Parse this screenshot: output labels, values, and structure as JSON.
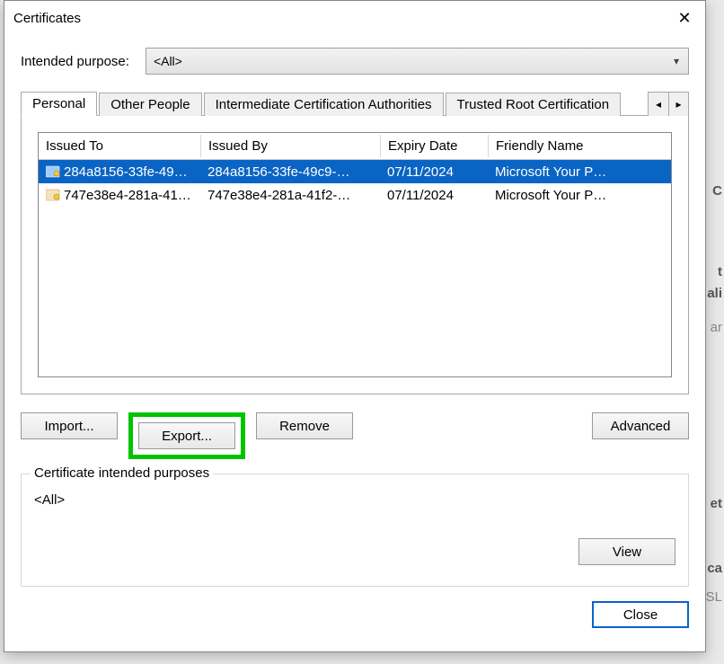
{
  "window": {
    "title": "Certificates"
  },
  "intended_purpose": {
    "label": "Intended purpose:",
    "value": "<All>"
  },
  "tabs": [
    {
      "label": "Personal",
      "active": true
    },
    {
      "label": "Other People",
      "active": false
    },
    {
      "label": "Intermediate Certification Authorities",
      "active": false
    },
    {
      "label": "Trusted Root Certification",
      "active": false,
      "truncated": true
    }
  ],
  "list": {
    "columns": {
      "issued_to": "Issued To",
      "issued_by": "Issued By",
      "expiry_date": "Expiry Date",
      "friendly_name": "Friendly Name"
    },
    "rows": [
      {
        "issued_to": "284a8156-33fe-49…",
        "issued_by": "284a8156-33fe-49c9-…",
        "expiry_date": "07/11/2024",
        "friendly_name": "Microsoft Your P…",
        "selected": true,
        "icon_tint": "blue"
      },
      {
        "issued_to": "747e38e4-281a-41…",
        "issued_by": "747e38e4-281a-41f2-…",
        "expiry_date": "07/11/2024",
        "friendly_name": "Microsoft Your P…",
        "selected": false,
        "icon_tint": "tan"
      }
    ]
  },
  "buttons": {
    "import": "Import...",
    "export": "Export...",
    "remove": "Remove",
    "advanced": "Advanced",
    "view": "View",
    "close": "Close"
  },
  "purposes_group": {
    "label": "Certificate intended purposes",
    "value": "<All>"
  },
  "highlight": {
    "target_button": "export",
    "color": "#00c400"
  },
  "background_fragments": [
    "C",
    "t",
    "ali",
    "ar",
    "et",
    "ca",
    "SL"
  ]
}
